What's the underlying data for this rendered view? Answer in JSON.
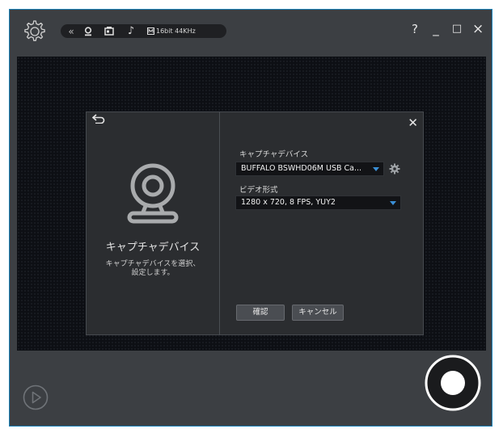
{
  "toolbar": {
    "audio_format": "16bit 44KHz",
    "icons": [
      "gear-icon",
      "double-chevron-left-icon",
      "webcam-icon",
      "capture-card-icon",
      "music-note-icon",
      "audio-format-icon"
    ]
  },
  "window_controls": {
    "help": "?",
    "minimize": "_",
    "maximize": "□",
    "close": "×"
  },
  "dialog": {
    "left_title": "キャプチャデバイス",
    "left_desc_line1": "キャプチャデバイスを選択、",
    "left_desc_line2": "設定します。",
    "capture_device_label": "キャプチャデバイス",
    "capture_device_value": "BUFFALO BSWHD06M USB Ca...",
    "video_format_label": "ビデオ形式",
    "video_format_value": "1280 x 720, 8 FPS, YUY2",
    "confirm_label": "確認",
    "cancel_label": "キャンセル",
    "close_glyph": "✕",
    "back_glyph": "⮌"
  },
  "colors": {
    "frame_border": "#1b82b8",
    "accent": "#3a8fd6",
    "frame_bg": "#3c3f43"
  }
}
